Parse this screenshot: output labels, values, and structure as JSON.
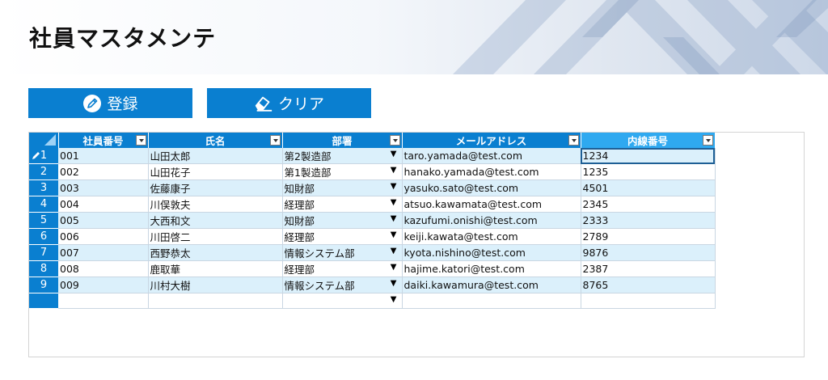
{
  "page": {
    "title": "社員マスタメンテ"
  },
  "buttons": {
    "register_label": "登録",
    "clear_label": "クリア"
  },
  "grid": {
    "columns": [
      "社員番号",
      "氏名",
      "部署",
      "メールアドレス",
      "内線番号"
    ],
    "rows": [
      {
        "num": "1",
        "id": "001",
        "name": "山田太郎",
        "dept": "第2製造部",
        "email": "taro.yamada@test.com",
        "ext": "1234"
      },
      {
        "num": "2",
        "id": "002",
        "name": "山田花子",
        "dept": "第1製造部",
        "email": "hanako.yamada@test.com",
        "ext": "1235"
      },
      {
        "num": "3",
        "id": "003",
        "name": "佐藤康子",
        "dept": "知財部",
        "email": "yasuko.sato@test.com",
        "ext": "4501"
      },
      {
        "num": "4",
        "id": "004",
        "name": "川俣敦夫",
        "dept": "経理部",
        "email": "atsuo.kawamata@test.com",
        "ext": "2345"
      },
      {
        "num": "5",
        "id": "005",
        "name": "大西和文",
        "dept": "知財部",
        "email": "kazufumi.onishi@test.com",
        "ext": "2333"
      },
      {
        "num": "6",
        "id": "006",
        "name": "川田啓二",
        "dept": "経理部",
        "email": "keiji.kawata@test.com",
        "ext": "2789"
      },
      {
        "num": "7",
        "id": "007",
        "name": "西野恭太",
        "dept": "情報システム部",
        "email": "kyota.nishino@test.com",
        "ext": "9876"
      },
      {
        "num": "8",
        "id": "008",
        "name": "鹿取華",
        "dept": "経理部",
        "email": "hajime.katori@test.com",
        "ext": "2387"
      },
      {
        "num": "9",
        "id": "009",
        "name": "川村大樹",
        "dept": "情報システム部",
        "email": "daiki.kawamura@test.com",
        "ext": "8765"
      }
    ],
    "dropdown_glyph": "▼"
  },
  "colors": {
    "accent": "#0a7fd0",
    "row_alt": "#dbf0fb"
  }
}
